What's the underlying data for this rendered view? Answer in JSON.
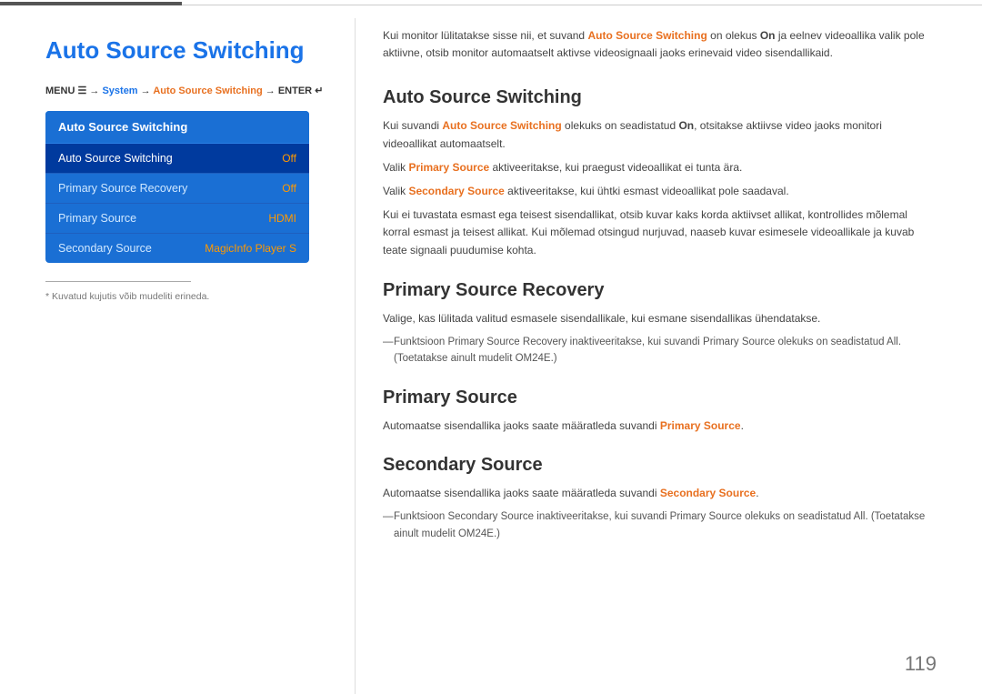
{
  "topbar": {},
  "left": {
    "title": "Auto Source Switching",
    "menu_path": {
      "prefix": "MENU ",
      "icon": "☰",
      "arrow1": " → ",
      "system": "System",
      "arrow2": " → ",
      "auto": "Auto Source Switching",
      "arrow3": " → ENTER ",
      "enter_icon": "↵"
    },
    "menu_box": {
      "header": "Auto Source Switching",
      "items": [
        {
          "label": "Auto Source Switching",
          "value": "Off",
          "active": true
        },
        {
          "label": "Primary Source Recovery",
          "value": "Off",
          "active": false
        },
        {
          "label": "Primary Source",
          "value": "HDMI",
          "active": false
        },
        {
          "label": "Secondary Source",
          "value": "MagicInfo Player S",
          "active": false
        }
      ]
    },
    "note": "* Kuvatud kujutis võib mudeliti erineda."
  },
  "right": {
    "intro": {
      "text1": "Kui monitor lülitatakse sisse nii, et suvand ",
      "highlight1": "Auto Source Switching",
      "text2": " on olekus ",
      "highlight2": "On",
      "text3": " ja eelnev videoallika valik pole aktiivne, otsib monitor automaatselt aktivse videosignaali jaoks erinevaid video sisendallikaid."
    },
    "sections": [
      {
        "id": "auto-source",
        "title": "Auto Source Switching",
        "paragraphs": [
          {
            "type": "text",
            "content": [
              {
                "type": "normal",
                "text": "Kui suvandi "
              },
              {
                "type": "orange-bold",
                "text": "Auto Source Switching"
              },
              {
                "type": "normal",
                "text": " olekuks on seadistatud "
              },
              {
                "type": "bold",
                "text": "On"
              },
              {
                "type": "normal",
                "text": ", otsitakse aktiivse video jaoks monitori videoallikat automaatselt."
              }
            ]
          },
          {
            "type": "text",
            "content": [
              {
                "type": "normal",
                "text": "Valik "
              },
              {
                "type": "orange-bold",
                "text": "Primary Source"
              },
              {
                "type": "normal",
                "text": " aktiveeritakse, kui praegust videoallikat ei tunta ära."
              }
            ]
          },
          {
            "type": "text",
            "content": [
              {
                "type": "normal",
                "text": "Valik "
              },
              {
                "type": "orange-bold",
                "text": "Secondary Source"
              },
              {
                "type": "normal",
                "text": " aktiveeritakse, kui ühtki esmast videoallikat pole saadaval."
              }
            ]
          },
          {
            "type": "text",
            "content": [
              {
                "type": "normal",
                "text": "Kui ei tuvastata esmast ega teisest sisendallikat, otsib kuvar kaks korda aktiivset allikat, kontrollides mõlemal korral esmast ja teisest allikat. Kui mõlemad otsingud nurjuvad, naaseb kuvar esimesele videoallikale ja kuvab teate signaali puudumise kohta."
              }
            ]
          }
        ]
      },
      {
        "id": "primary-source-recovery",
        "title": "Primary Source Recovery",
        "paragraphs": [
          {
            "type": "text",
            "content": [
              {
                "type": "normal",
                "text": "Valige, kas lülitada valitud esmasele sisendallikale, kui esmane sisendallikas ühendatakse."
              }
            ]
          },
          {
            "type": "note",
            "content": [
              {
                "type": "normal",
                "text": "Funktsioon "
              },
              {
                "type": "orange-bold",
                "text": "Primary Source Recovery"
              },
              {
                "type": "normal",
                "text": " inaktiveeritakse, kui suvandi "
              },
              {
                "type": "orange-bold",
                "text": "Primary Source"
              },
              {
                "type": "normal",
                "text": " olekuks on seadistatud "
              },
              {
                "type": "bold",
                "text": "All"
              },
              {
                "type": "normal",
                "text": ". (Toetatakse ainult mudelit OM24E.)"
              }
            ]
          }
        ]
      },
      {
        "id": "primary-source",
        "title": "Primary Source",
        "paragraphs": [
          {
            "type": "text",
            "content": [
              {
                "type": "normal",
                "text": "Automaatse sisendallika jaoks saate määratleda suvandi "
              },
              {
                "type": "orange-bold",
                "text": "Primary Source"
              },
              {
                "type": "normal",
                "text": "."
              }
            ]
          }
        ]
      },
      {
        "id": "secondary-source",
        "title": "Secondary Source",
        "paragraphs": [
          {
            "type": "text",
            "content": [
              {
                "type": "normal",
                "text": "Automaatse sisendallika jaoks saate määratleda suvandi "
              },
              {
                "type": "orange-bold",
                "text": "Secondary Source"
              },
              {
                "type": "normal",
                "text": "."
              }
            ]
          },
          {
            "type": "note",
            "content": [
              {
                "type": "normal",
                "text": "Funktsioon "
              },
              {
                "type": "orange-bold",
                "text": "Secondary Source"
              },
              {
                "type": "normal",
                "text": " inaktiveeritakse, kui suvandi "
              },
              {
                "type": "orange-bold",
                "text": "Primary Source"
              },
              {
                "type": "normal",
                "text": " olekuks on seadistatud "
              },
              {
                "type": "bold",
                "text": "All"
              },
              {
                "type": "normal",
                "text": ". (Toetatakse ainult mudelit OM24E.)"
              }
            ]
          }
        ]
      }
    ]
  },
  "page_number": "119"
}
